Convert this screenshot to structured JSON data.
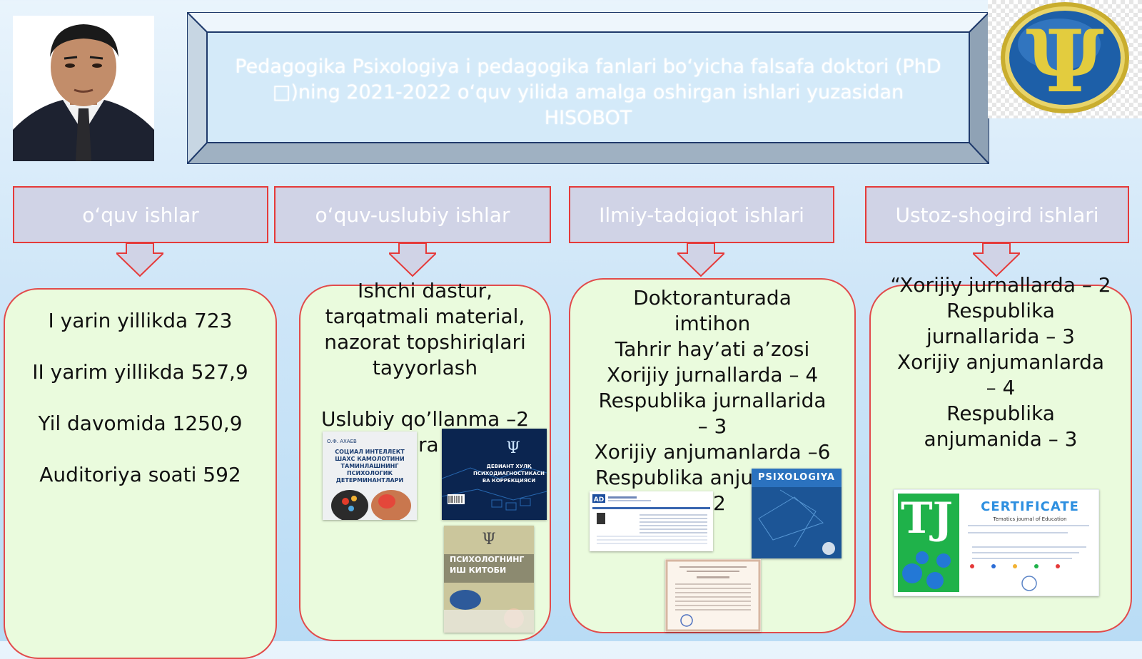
{
  "title": {
    "line1": "Pedagogika  Psixologiya  i pedagogika fanlari bo‘yicha falsafa doktori (PhD",
    "line2": ")ning 2021-2022 o‘quv yilida amalga oshirgan ishlari yuzasidan",
    "line3": "HISOBOT"
  },
  "categories": [
    {
      "label": "o‘quv ishlar"
    },
    {
      "label": "o‘quv-uslubiy ishlar"
    },
    {
      "label": "Ilmiy-tadqiqot ishlari"
    },
    {
      "label": "Ustoz-shogird ishlari"
    }
  ],
  "box1": {
    "lines": [
      "I yarin yillikda  723",
      "II yarim yillikda 527,9",
      "Yil davomida  1250,9",
      "Auditoriya soati 592"
    ]
  },
  "box2": {
    "text": "Ishchi dastur,\ntarqatmali material,\nnazorat topshiriqlari\ntayyorlash\n\nUslubiy qo’llanma –2",
    "partial": "ra",
    "book1_author": "О.Ф. АХАЕВ",
    "book1_title": "СОЦИАЛ ИНТЕЛЛЕКТ ШАХС КАМОЛОТИНИ ТАМИНЛАШНИНГ ПСИХОЛОГИК ДЕТЕРМИНАНТЛАРИ",
    "book2_title": "ДЕВИАНТ ХУЛҚ ПСИХОДИАГНОСТИКАСИ ВА КОРРЕКЦИЯСИ",
    "book3_title": "ПСИХОЛОГНИНГ ИШ КИТОБИ"
  },
  "box3": {
    "text": "Doktoranturada\nimtihon\nTahrir hay’ati a’zosi\nXorijiy jurnallarda – 4\nRespublika jurnallarida\n– 3\nXorijiy anjumanlarda –6",
    "partial_line": "Respublika anju",
    "partial_num": "2",
    "journal_title": "PSIXOLOGIYA",
    "journal_logo": "AD"
  },
  "box4": {
    "text": "“Xorijiy jurnallarda – 2\nRespublika\njurnallarida – 3\nXorijiy anjumanlarda\n– 4\nRespublika\nanjumanida – 3",
    "cert_title": "CERTIFICATE",
    "cert_logo": "TJ",
    "cert_sub": "Tematics journal of Education"
  },
  "colors": {
    "border_red": "#e53a3a",
    "header_fill": "#d0d3e6",
    "box_fill": "#eafbdd",
    "frame_blue": "#1f3a6b",
    "logo_blue": "#1d5fa8",
    "logo_gold": "#d8c23a"
  }
}
